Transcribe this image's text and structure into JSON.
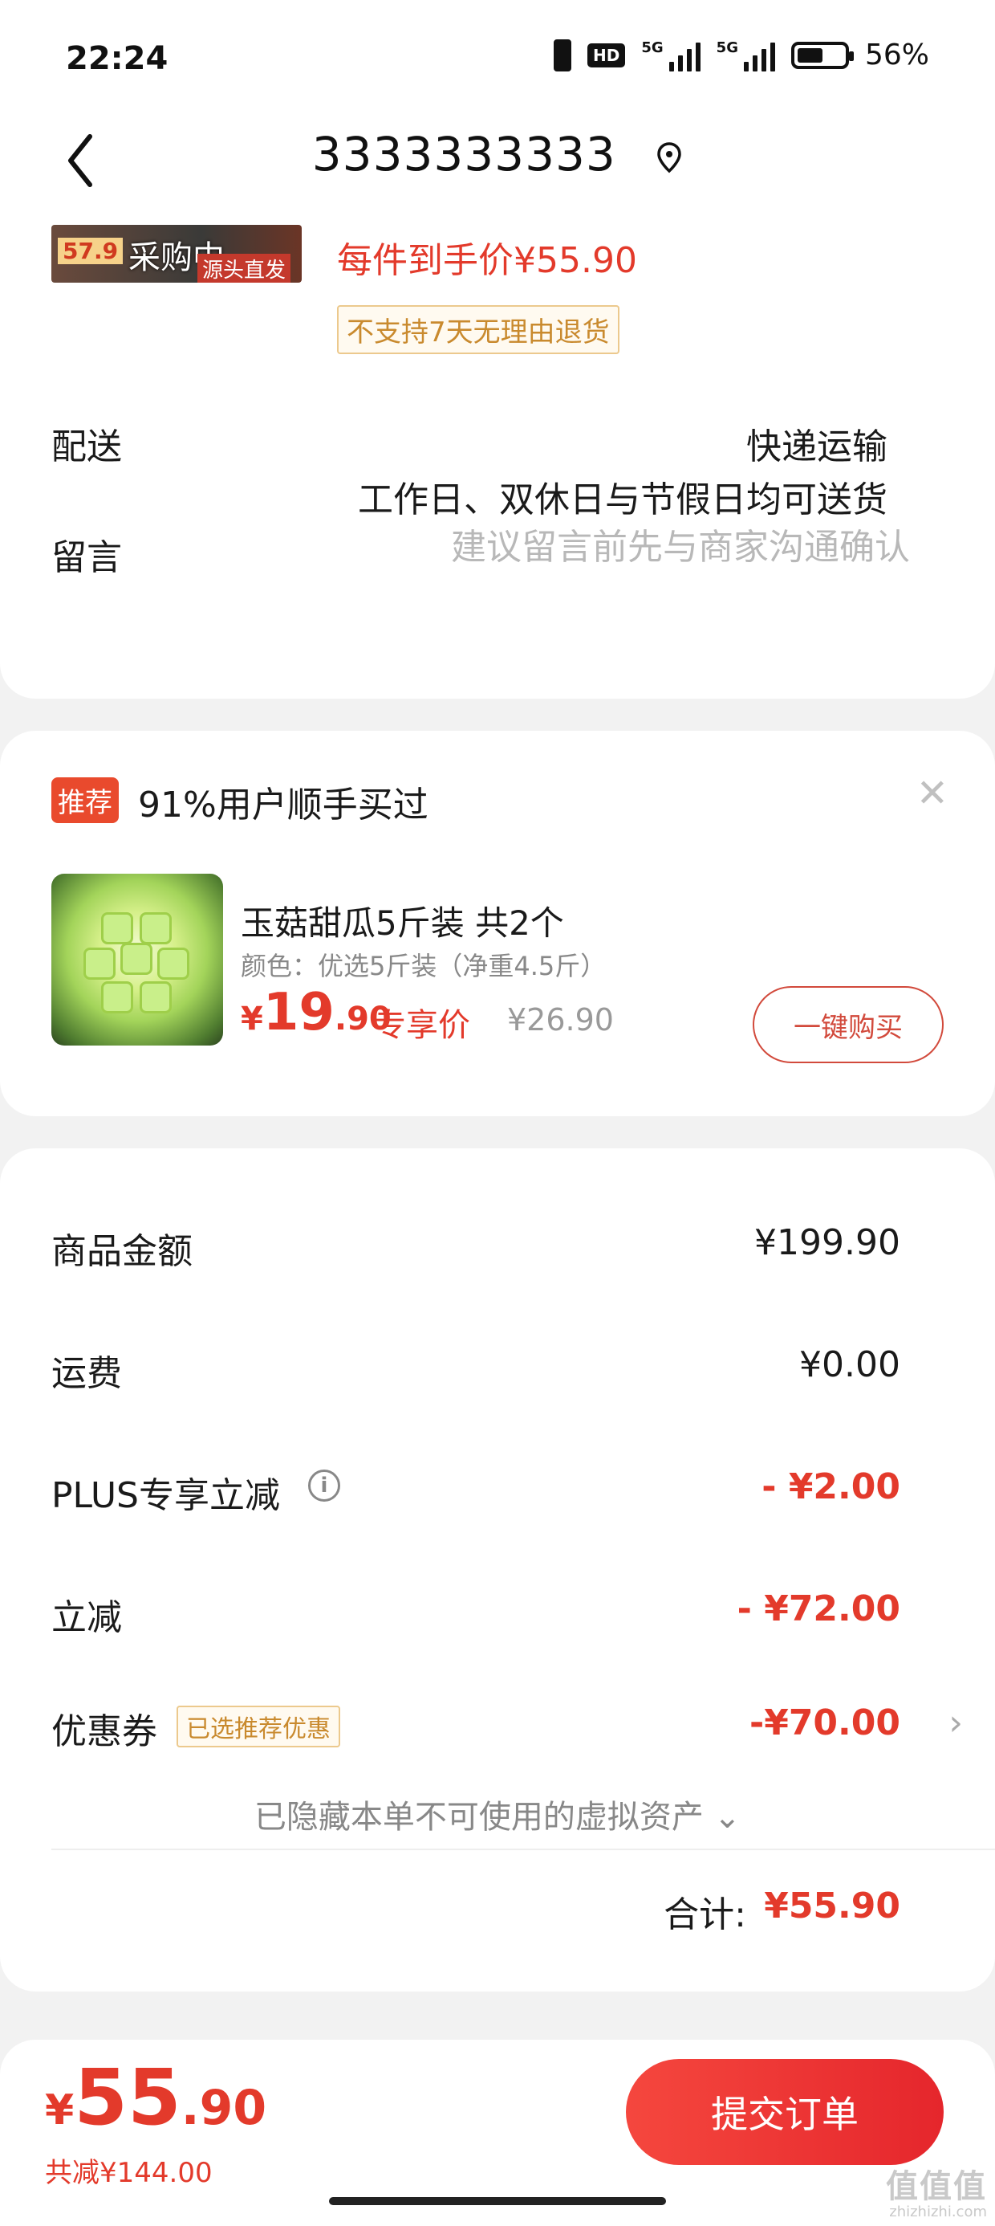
{
  "status_bar": {
    "time": "22:24",
    "network_1": "5G",
    "network_2": "5G",
    "hd_label": "HD",
    "battery_percent": "56%",
    "battery_level": 0.56
  },
  "header": {
    "title": "3333333333",
    "back_icon": "chevron-left-icon",
    "location_icon": "location-pin-icon"
  },
  "order_item": {
    "thumb_price": "57.9",
    "thumb_status": "采购中",
    "thumb_source": "源头直发",
    "unit_price": "每件到手价¥55.90",
    "return_policy": "不支持7天无理由退货"
  },
  "delivery": {
    "label": "配送",
    "method": "快递运输",
    "note": "工作日、双休日与节假日均可送货"
  },
  "message": {
    "label": "留言",
    "placeholder": "建议留言前先与商家沟通确认"
  },
  "recommend": {
    "badge": "推荐",
    "text": "91%用户顺手买过",
    "close_icon": "close-icon",
    "product_name": "玉菇甜瓜5斤装 共2个",
    "spec": "颜色：优选5斤装（净重4.5斤）",
    "price_symbol": "¥",
    "price_int": "19",
    "price_dec": ".90",
    "price_label": "专享价",
    "original_price": "¥26.90",
    "buy_button": "一键购买"
  },
  "summary": {
    "rows": [
      {
        "label": "商品金额",
        "value": "¥199.90"
      },
      {
        "label": "运费",
        "value": "¥0.00"
      },
      {
        "label": "PLUS专享立减",
        "value": "- ¥2.00"
      },
      {
        "label": "立减",
        "value": "- ¥72.00"
      },
      {
        "label": "优惠券",
        "value": "-¥70.00"
      }
    ],
    "coupon_tag": "已选推荐优惠",
    "hidden_assets": "已隐藏本单不可使用的虚拟资产",
    "total_label": "合计:",
    "total_value": "¥55.90"
  },
  "checkout": {
    "price_symbol": "¥",
    "price_int": "55",
    "price_dec": ".90",
    "saved": "共减¥144.00",
    "submit": "提交订单"
  },
  "watermark": {
    "text": "值值值",
    "sub": "zhizhizhi.com"
  },
  "colors": {
    "accent_red": "#e33a2b",
    "coupon_gold": "#c98a2e",
    "submit_gradient_start": "#f5473e",
    "submit_gradient_end": "#e5262c"
  }
}
